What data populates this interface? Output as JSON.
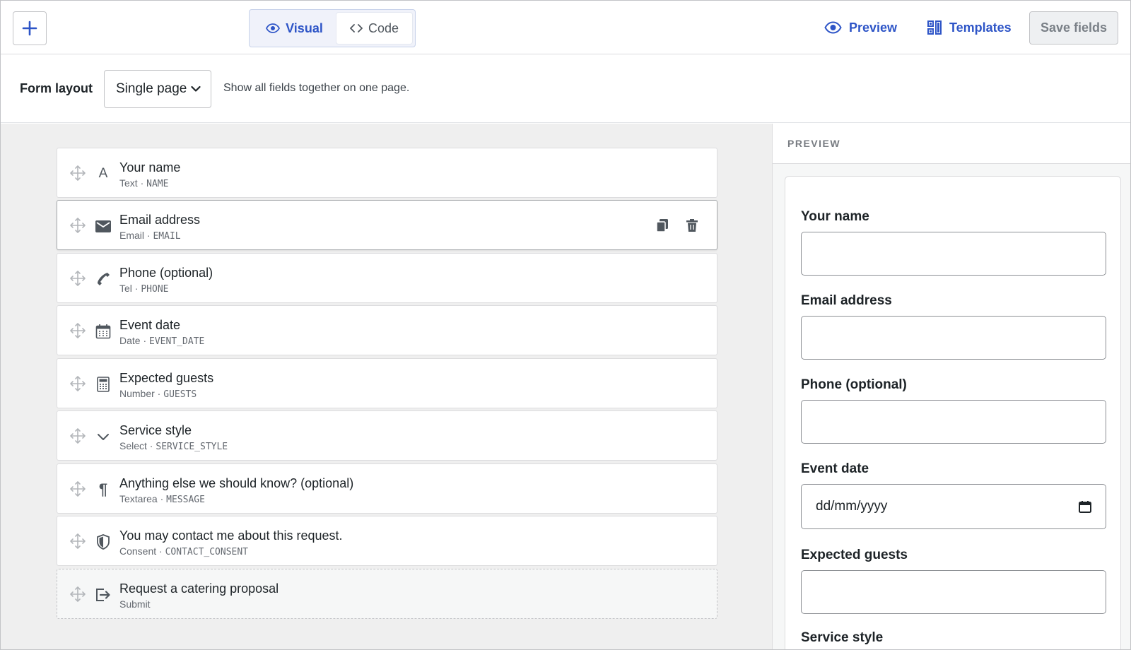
{
  "toolbar": {
    "add_icon": "plus-icon",
    "modes": {
      "visual": "Visual",
      "code": "Code",
      "active": "visual"
    },
    "preview_label": "Preview",
    "templates_label": "Templates",
    "save_label": "Save fields",
    "accent": "#2e55c7"
  },
  "layout": {
    "label": "Form layout",
    "value": "Single page",
    "help": "Show all fields together on one page."
  },
  "fields": [
    {
      "label": "Your name",
      "type": "Text",
      "key": "NAME",
      "icon": "text-icon"
    },
    {
      "label": "Email address",
      "type": "Email",
      "key": "EMAIL",
      "icon": "envelope-icon",
      "selected": true
    },
    {
      "label": "Phone (optional)",
      "type": "Tel",
      "key": "PHONE",
      "icon": "phone-icon"
    },
    {
      "label": "Event date",
      "type": "Date",
      "key": "EVENT_DATE",
      "icon": "calendar-icon"
    },
    {
      "label": "Expected guests",
      "type": "Number",
      "key": "GUESTS",
      "icon": "calculator-icon"
    },
    {
      "label": "Service style",
      "type": "Select",
      "key": "SERVICE_STYLE",
      "icon": "chevron-down-icon"
    },
    {
      "label": "Anything else we should know? (optional)",
      "type": "Textarea",
      "key": "MESSAGE",
      "icon": "paragraph-icon"
    },
    {
      "label": "You may contact me about this request.",
      "type": "Consent",
      "key": "CONTACT_CONSENT",
      "icon": "shield-icon"
    },
    {
      "label": "Request a catering proposal",
      "type": "Submit",
      "key": "",
      "icon": "submit-icon"
    }
  ],
  "preview": {
    "header": "PREVIEW",
    "fields": [
      {
        "label": "Your name",
        "value": ""
      },
      {
        "label": "Email address",
        "value": ""
      },
      {
        "label": "Phone (optional)",
        "value": ""
      },
      {
        "label": "Event date",
        "value": "dd/mm/yyyy"
      },
      {
        "label": "Expected guests",
        "value": ""
      },
      {
        "label": "Service style",
        "value": ""
      }
    ]
  }
}
